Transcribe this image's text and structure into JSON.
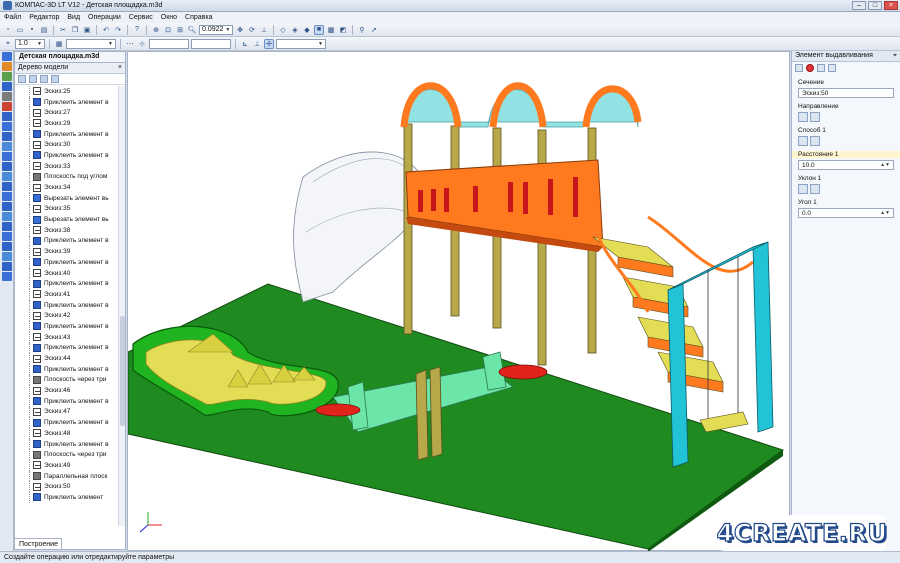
{
  "window": {
    "title": "КОМПАС-3D LT V12 - Детская площадка.m3d"
  },
  "menu": [
    "Файл",
    "Редактор",
    "Вид",
    "Операции",
    "Сервис",
    "Окно",
    "Справка"
  ],
  "toolbar": {
    "scale_value": "1.0",
    "zoom_value": "0.0922"
  },
  "document_tab": "Детская площадка.m3d",
  "tree": {
    "title": "Дерево модели",
    "items": [
      {
        "label": "Эскиз:25",
        "type": "sketch"
      },
      {
        "label": "Приклеить элемент в",
        "type": "extrude"
      },
      {
        "label": "Эскиз:27",
        "type": "sketch"
      },
      {
        "label": "Эскиз:29",
        "type": "sketch"
      },
      {
        "label": "Приклеить элемент в",
        "type": "extrude"
      },
      {
        "label": "Эскиз:30",
        "type": "sketch"
      },
      {
        "label": "Приклеить элемент в",
        "type": "extrude"
      },
      {
        "label": "Эскиз:33",
        "type": "sketch"
      },
      {
        "label": "Плоскость под углом",
        "type": "plane"
      },
      {
        "label": "Эскиз:34",
        "type": "sketch"
      },
      {
        "label": "Вырезать элемент вь",
        "type": "cut"
      },
      {
        "label": "Эскиз:35",
        "type": "sketch"
      },
      {
        "label": "Вырезать элемент вь",
        "type": "cut"
      },
      {
        "label": "Эскиз:38",
        "type": "sketch"
      },
      {
        "label": "Приклеить элемент в",
        "type": "extrude"
      },
      {
        "label": "Эскиз:39",
        "type": "sketch"
      },
      {
        "label": "Приклеить элемент в",
        "type": "extrude"
      },
      {
        "label": "Эскиз:40",
        "type": "sketch"
      },
      {
        "label": "Приклеить элемент в",
        "type": "extrude"
      },
      {
        "label": "Эскиз:41",
        "type": "sketch"
      },
      {
        "label": "Приклеить элемент в",
        "type": "extrude"
      },
      {
        "label": "Эскиз:42",
        "type": "sketch"
      },
      {
        "label": "Приклеить элемент в",
        "type": "extrude"
      },
      {
        "label": "Эскиз:43",
        "type": "sketch"
      },
      {
        "label": "Приклеить элемент в",
        "type": "extrude"
      },
      {
        "label": "Эскиз:44",
        "type": "sketch"
      },
      {
        "label": "Приклеить элемент в",
        "type": "extrude"
      },
      {
        "label": "Плоскость через три",
        "type": "plane"
      },
      {
        "label": "Эскиз:46",
        "type": "sketch"
      },
      {
        "label": "Приклеить элемент в",
        "type": "extrude"
      },
      {
        "label": "Эскиз:47",
        "type": "sketch"
      },
      {
        "label": "Приклеить элемент в",
        "type": "extrude"
      },
      {
        "label": "Эскиз:48",
        "type": "sketch"
      },
      {
        "label": "Приклеить элемент в",
        "type": "extrude"
      },
      {
        "label": "Плоскость через три",
        "type": "plane"
      },
      {
        "label": "Эскиз:49",
        "type": "sketch"
      },
      {
        "label": "Параллельная плоск",
        "type": "plane"
      },
      {
        "label": "Эскиз:50",
        "type": "sketch"
      },
      {
        "label": "Приклеить элемент",
        "type": "extrude"
      }
    ]
  },
  "build_tab": "Построение",
  "properties": {
    "title": "Элемент выдавливания",
    "section_label": "Сечение",
    "section_value": "Эскиз:50",
    "direction_label": "Направление",
    "method_label": "Способ 1",
    "distance_label": "Расстояние 1",
    "distance_value": "10.0",
    "slope_label": "Уклон 1",
    "angle_label": "Угол 1",
    "angle_value": "0.0"
  },
  "status": "Создайте операцию или отредактируйте параметры",
  "watermark": "4CREATE.RU",
  "colors": {
    "ground": "#1f8a1f",
    "frame_orange": "#ff7a1f",
    "roof": "#7fdde0",
    "post": "#b7a84a",
    "swing": "#22c3d6",
    "seesaw": "#6ce6a8",
    "accent_blue": "#2f63c8"
  }
}
